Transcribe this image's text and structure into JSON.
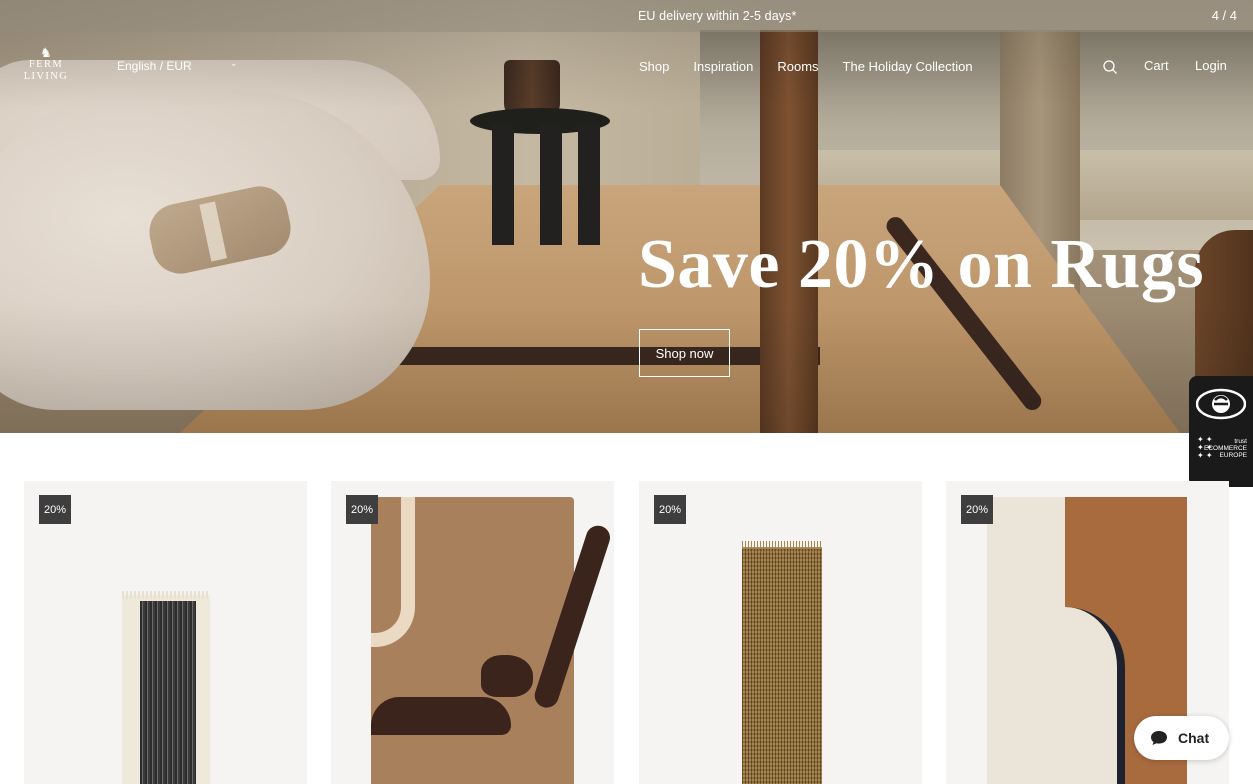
{
  "announcement": {
    "message": "EU delivery within 2-5 days*",
    "counter": "4 / 4"
  },
  "logo": {
    "line1": "FERM",
    "line2": "LIVING"
  },
  "locale": {
    "label": "English / EUR",
    "caret": "⌄"
  },
  "nav": {
    "items": [
      "Shop",
      "Inspiration",
      "Rooms",
      "The Holiday Collection"
    ],
    "cart": "Cart",
    "login": "Login"
  },
  "hero": {
    "headline": "Save 20% on Rugs",
    "cta": "Shop now"
  },
  "trust_badge": {
    "label": "trust ECOMMERCE EUROPE"
  },
  "products": [
    {
      "badge": "20%"
    },
    {
      "badge": "20%"
    },
    {
      "badge": "20%"
    },
    {
      "badge": "20%"
    }
  ],
  "chat": {
    "label": "Chat"
  },
  "colors": {
    "badge_bg": "#3e3e3e",
    "card_bg": "#f5f4f2",
    "text_on_hero": "#ffffff"
  }
}
